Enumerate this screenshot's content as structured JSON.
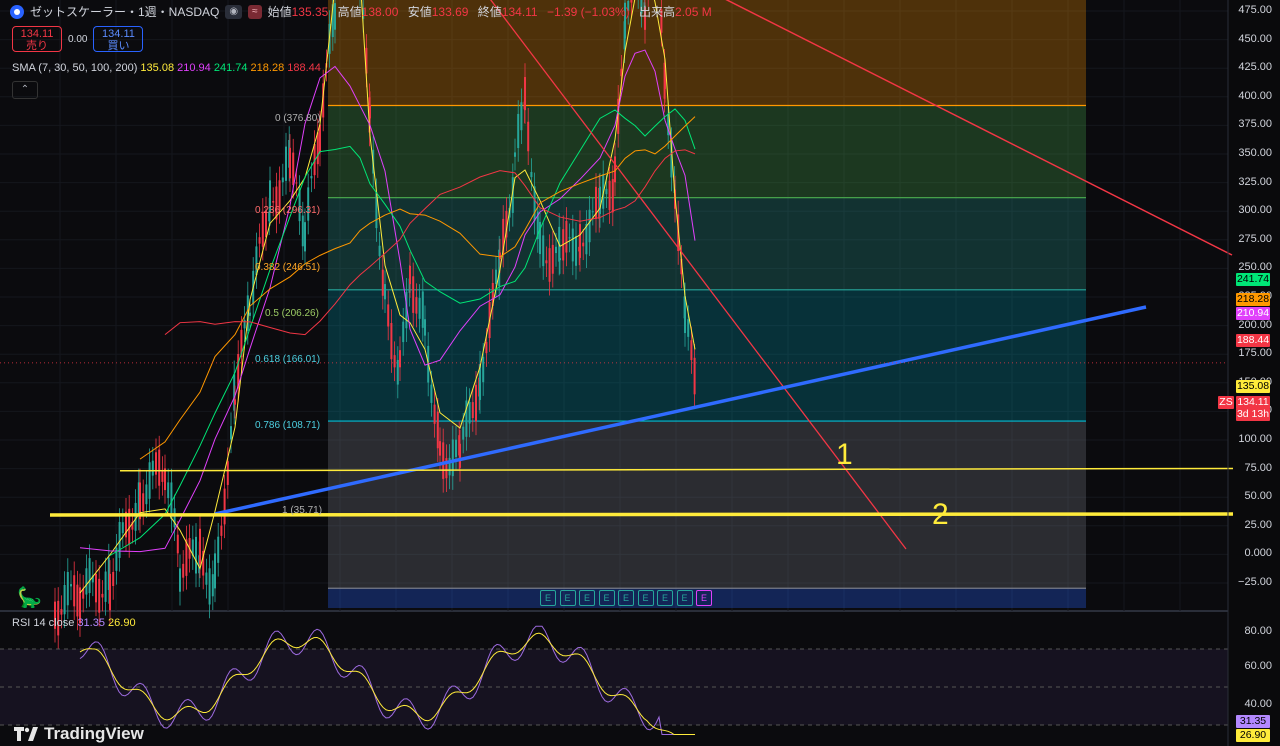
{
  "header": {
    "symbol_title": "ゼットスケーラー・1週・NASDAQ",
    "open_label": "始値",
    "open": "135.35",
    "high_label": "高値",
    "high": "138.00",
    "low_label": "安値",
    "low": "133.69",
    "close_label": "終値",
    "close": "134.11",
    "change": "−1.39 (−1.03%)",
    "volume_label": "出来高",
    "volume": "2.05 M",
    "pill_icon": "eye-icon",
    "pill2_icon": "approx-icon"
  },
  "trade": {
    "sell_price": "134.11",
    "sell_label": "売り",
    "spread": "0.00",
    "buy_price": "134.11",
    "buy_label": "買い"
  },
  "sma": {
    "label": "SMA (7, 30, 50, 100, 200)",
    "values": [
      {
        "v": "135.08",
        "color": "#ffeb3b"
      },
      {
        "v": "210.94",
        "color": "#e040fb"
      },
      {
        "v": "241.74",
        "color": "#00e676"
      },
      {
        "v": "218.28",
        "color": "#ff9800"
      },
      {
        "v": "188.44",
        "color": "#f23645"
      }
    ]
  },
  "rsi": {
    "label": "RSI 14 close",
    "v1": "31.35",
    "v2": "26.90",
    "c1": "#b388ff",
    "c2": "#ffeb3b"
  },
  "fib_labels": [
    "0 (376.80)",
    "0.236 (296.31)",
    "0.382 (246.51)",
    "0.5 (206.26)",
    "0.618 (166.01)",
    "0.786 (108.71)",
    "1 (35.71)"
  ],
  "y_axis": [
    "475.00",
    "450.00",
    "425.00",
    "400.00",
    "375.00",
    "350.00",
    "325.00",
    "300.00",
    "275.00",
    "250.00",
    "225.00",
    "200.00",
    "175.00",
    "150.00",
    "125.00",
    "100.00",
    "75.00",
    "50.00",
    "25.00",
    "0.000",
    "−25.00"
  ],
  "rsi_axis": [
    "80.00",
    "60.00",
    "40.00"
  ],
  "price_tags": [
    {
      "v": "241.74",
      "bg": "#00e676",
      "fg": "#000"
    },
    {
      "v": "218.28",
      "bg": "#ff9800",
      "fg": "#000"
    },
    {
      "v": "210.94",
      "bg": "#e040fb",
      "fg": "#fff"
    },
    {
      "v": "188.44",
      "bg": "#f23645",
      "fg": "#fff"
    },
    {
      "v": "135.08",
      "bg": "#ffeb3b",
      "fg": "#000"
    },
    {
      "v": "134.11",
      "bg": "#f23645",
      "fg": "#fff"
    }
  ],
  "countdown": "3d 13h",
  "zs_badge": "ZS",
  "rsi_tags": [
    {
      "v": "31.35",
      "bg": "#b388ff",
      "fg": "#000"
    },
    {
      "v": "26.90",
      "bg": "#ffeb3b",
      "fg": "#000"
    }
  ],
  "annotations": [
    "1",
    "2"
  ],
  "earnings_marker": "E",
  "brand": "TradingView",
  "collapse_icon": "chevron-up-icon",
  "dino_icon": "dinosaur-icon"
}
